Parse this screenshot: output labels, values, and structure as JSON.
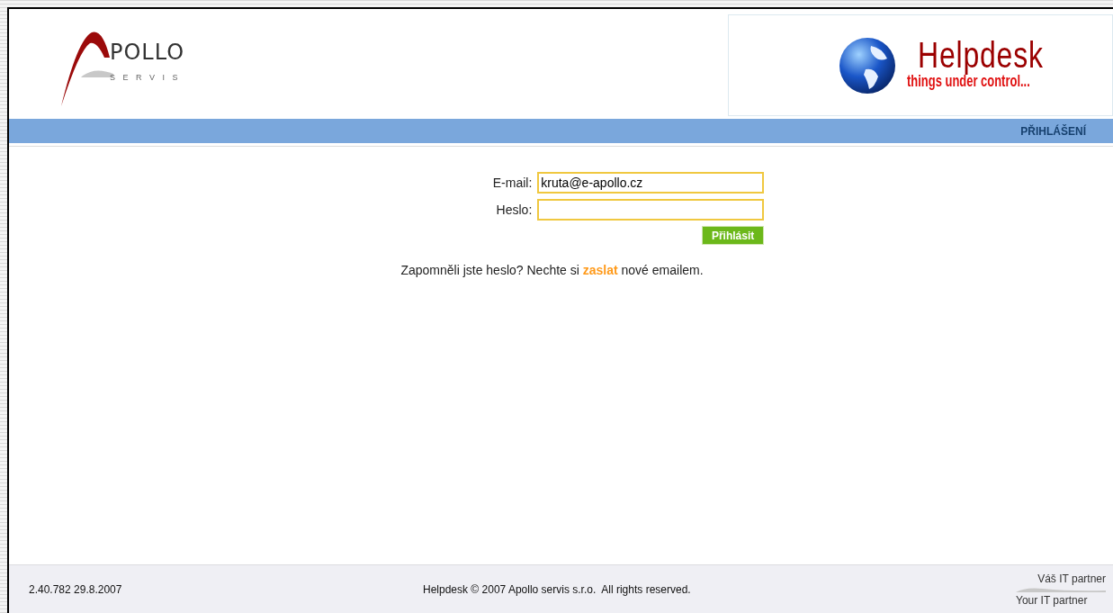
{
  "logo": {
    "wordmark": "POLLO",
    "subtitle": "S E R V I S"
  },
  "banner": {
    "title": "Helpdesk",
    "tagline": "things under control..."
  },
  "nav": {
    "items": [
      {
        "label": "PŘIHLÁŠENÍ"
      }
    ]
  },
  "form": {
    "fields": [
      {
        "label": "E-mail:",
        "value": "kruta@e-apollo.cz"
      },
      {
        "label": "Heslo:"
      }
    ],
    "submit": "Přihlásit"
  },
  "forgot": {
    "before": "Zapomněli jste heslo? Nechte si",
    "link": "zaslat",
    "after": "nové emailem."
  },
  "footer": {
    "version": "2.40.782 29.8.2007",
    "copyright": "Helpdesk © 2007 Apollo servis s.r.o.  All rights reserved.",
    "slogan_top": "Váš IT partner",
    "slogan_bottom": "Your IT partner"
  }
}
